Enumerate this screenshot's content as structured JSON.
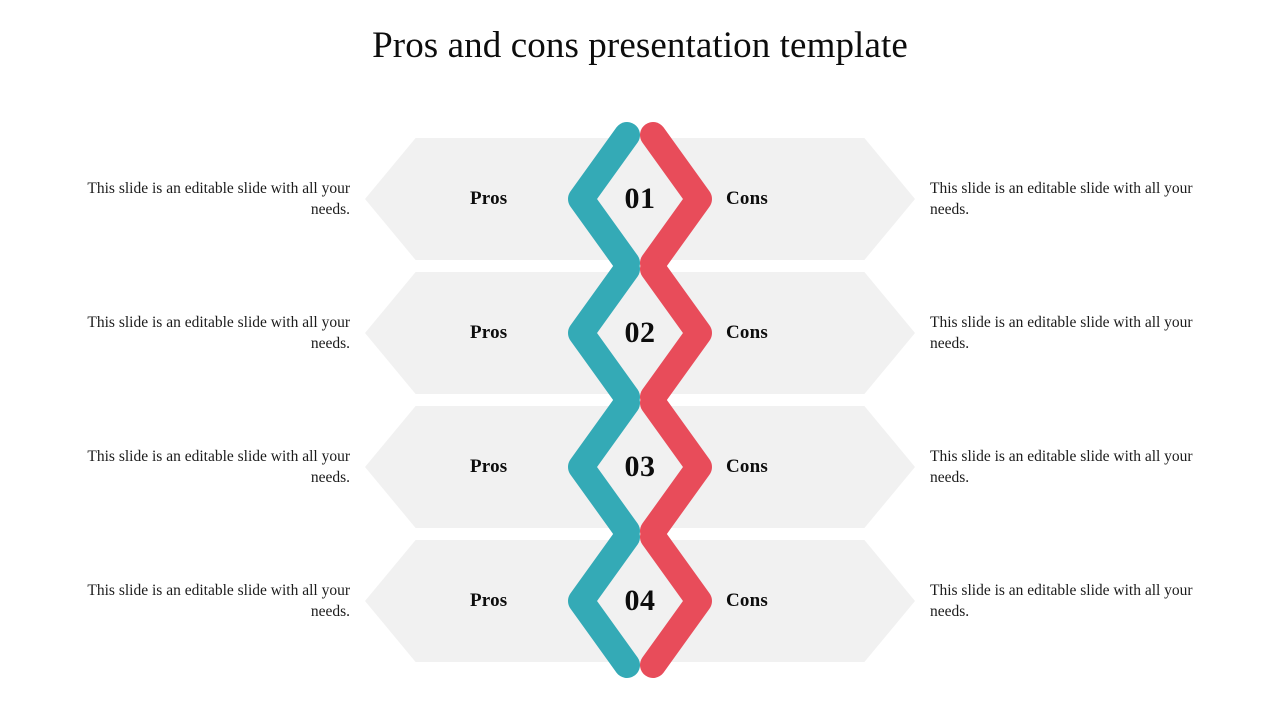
{
  "slide": {
    "title": "Pros and cons presentation template",
    "background_color": "#ffffff"
  },
  "theme": {
    "pros_color": "#34aab6",
    "cons_color": "#e84c5a",
    "band_color": "#f1f1f1",
    "text_color": "#1b1b1b",
    "title_color": "#0d0d0d"
  },
  "labels": {
    "pros": "Pros",
    "cons": "Cons"
  },
  "rows": [
    {
      "number": "01",
      "pros_label": "Pros",
      "cons_label": "Cons",
      "left_text": "This slide is an editable slide with all your needs.",
      "right_text": "This slide is an editable slide with all your needs."
    },
    {
      "number": "02",
      "pros_label": "Pros",
      "cons_label": "Cons",
      "left_text": "This slide is an editable slide with all your needs.",
      "right_text": "This slide is an editable slide with all your needs."
    },
    {
      "number": "03",
      "pros_label": "Pros",
      "cons_label": "Cons",
      "left_text": "This slide is an editable slide with all your needs.",
      "right_text": "This slide is an editable slide with all your needs."
    },
    {
      "number": "04",
      "pros_label": "Pros",
      "cons_label": "Cons",
      "left_text": "This slide is an editable slide with all your needs.",
      "right_text": "This slide is an editable slide with all your needs."
    }
  ]
}
